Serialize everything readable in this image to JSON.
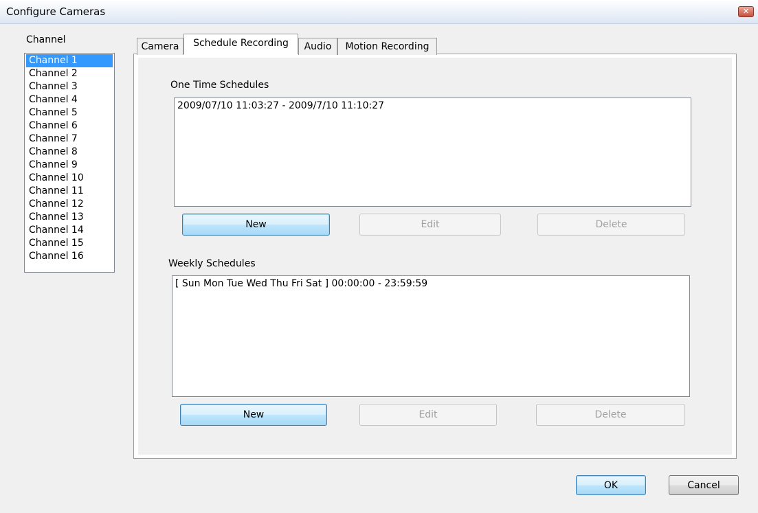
{
  "window": {
    "title": "Configure Cameras",
    "close_glyph": "✕"
  },
  "channel_panel": {
    "label": "Channel",
    "items": [
      "Channel 1",
      "Channel 2",
      "Channel 3",
      "Channel 4",
      "Channel 5",
      "Channel 6",
      "Channel 7",
      "Channel 8",
      "Channel 9",
      "Channel 10",
      "Channel 11",
      "Channel 12",
      "Channel 13",
      "Channel 14",
      "Channel 15",
      "Channel 16"
    ],
    "selected": "Channel 1"
  },
  "tabs": [
    {
      "label": "Camera",
      "active": false
    },
    {
      "label": "Schedule Recording",
      "active": true
    },
    {
      "label": "Audio",
      "active": false
    },
    {
      "label": "Motion Recording",
      "active": false
    }
  ],
  "one_time": {
    "label": "One Time Schedules",
    "entries": [
      "2009/07/10 11:03:27 - 2009/7/10 11:10:27"
    ],
    "new_label": "New",
    "edit_label": "Edit",
    "delete_label": "Delete"
  },
  "weekly": {
    "label": "Weekly Schedules",
    "entries": [
      "[ Sun Mon Tue Wed Thu Fri Sat ] 00:00:00 - 23:59:59"
    ],
    "new_label": "New",
    "edit_label": "Edit",
    "delete_label": "Delete"
  },
  "footer": {
    "ok_label": "OK",
    "cancel_label": "Cancel"
  }
}
